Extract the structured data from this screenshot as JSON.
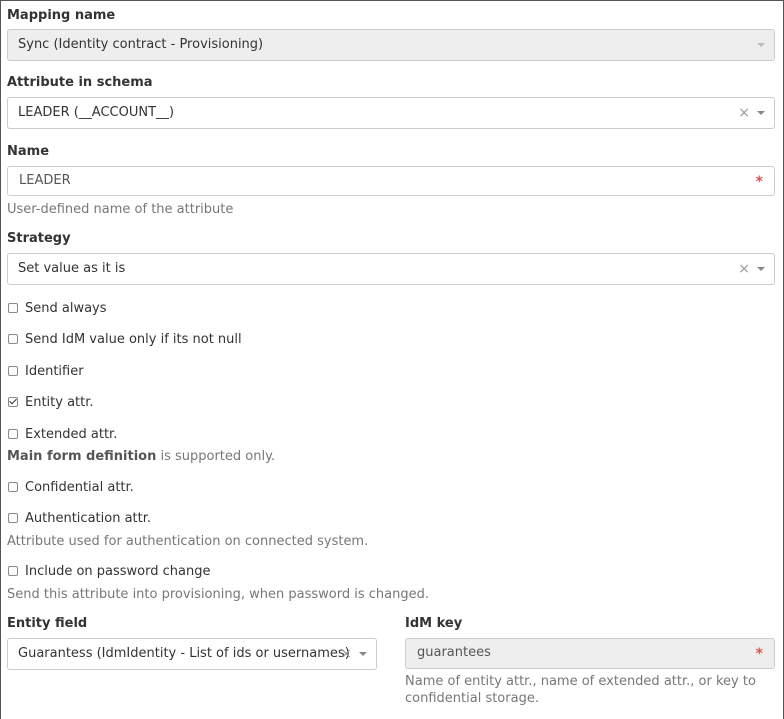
{
  "mapping_name": {
    "label": "Mapping name",
    "value": "Sync (Identity contract - Provisioning)"
  },
  "attribute_in_schema": {
    "label": "Attribute in schema",
    "value": "LEADER (__ACCOUNT__)",
    "clear": "×"
  },
  "name": {
    "label": "Name",
    "value": "LEADER",
    "required_mark": "*",
    "help": "User-defined name of the attribute"
  },
  "strategy": {
    "label": "Strategy",
    "value": "Set value as it is",
    "clear": "×"
  },
  "checkboxes": {
    "send_always": {
      "label": "Send always",
      "checked": false
    },
    "send_idm_not_null": {
      "label": "Send IdM value only if its not null",
      "checked": false
    },
    "identifier": {
      "label": "Identifier",
      "checked": false
    },
    "entity_attr": {
      "label": "Entity attr.",
      "checked": true
    },
    "extended_attr": {
      "label": "Extended attr.",
      "checked": false
    },
    "confidential_attr": {
      "label": "Confidential attr.",
      "checked": false
    },
    "authentication_attr": {
      "label": "Authentication attr.",
      "checked": false
    },
    "include_on_password_change": {
      "label": "Include on password change",
      "checked": false
    }
  },
  "extended_help": {
    "bold": "Main form definition",
    "rest": " is supported only."
  },
  "authentication_help": "Attribute used for authentication on connected system.",
  "password_change_help": "Send this attribute into provisioning, when password is changed.",
  "entity_field": {
    "label": "Entity field",
    "value": "Guarantess (IdmIdentity - List of ids or usernames)",
    "clear": "×"
  },
  "idm_key": {
    "label": "IdM key",
    "value": "guarantees",
    "required_mark": "*",
    "help_line1": "Name of entity attr., name of extended attr., or key to",
    "help_line2": "confidential storage."
  }
}
